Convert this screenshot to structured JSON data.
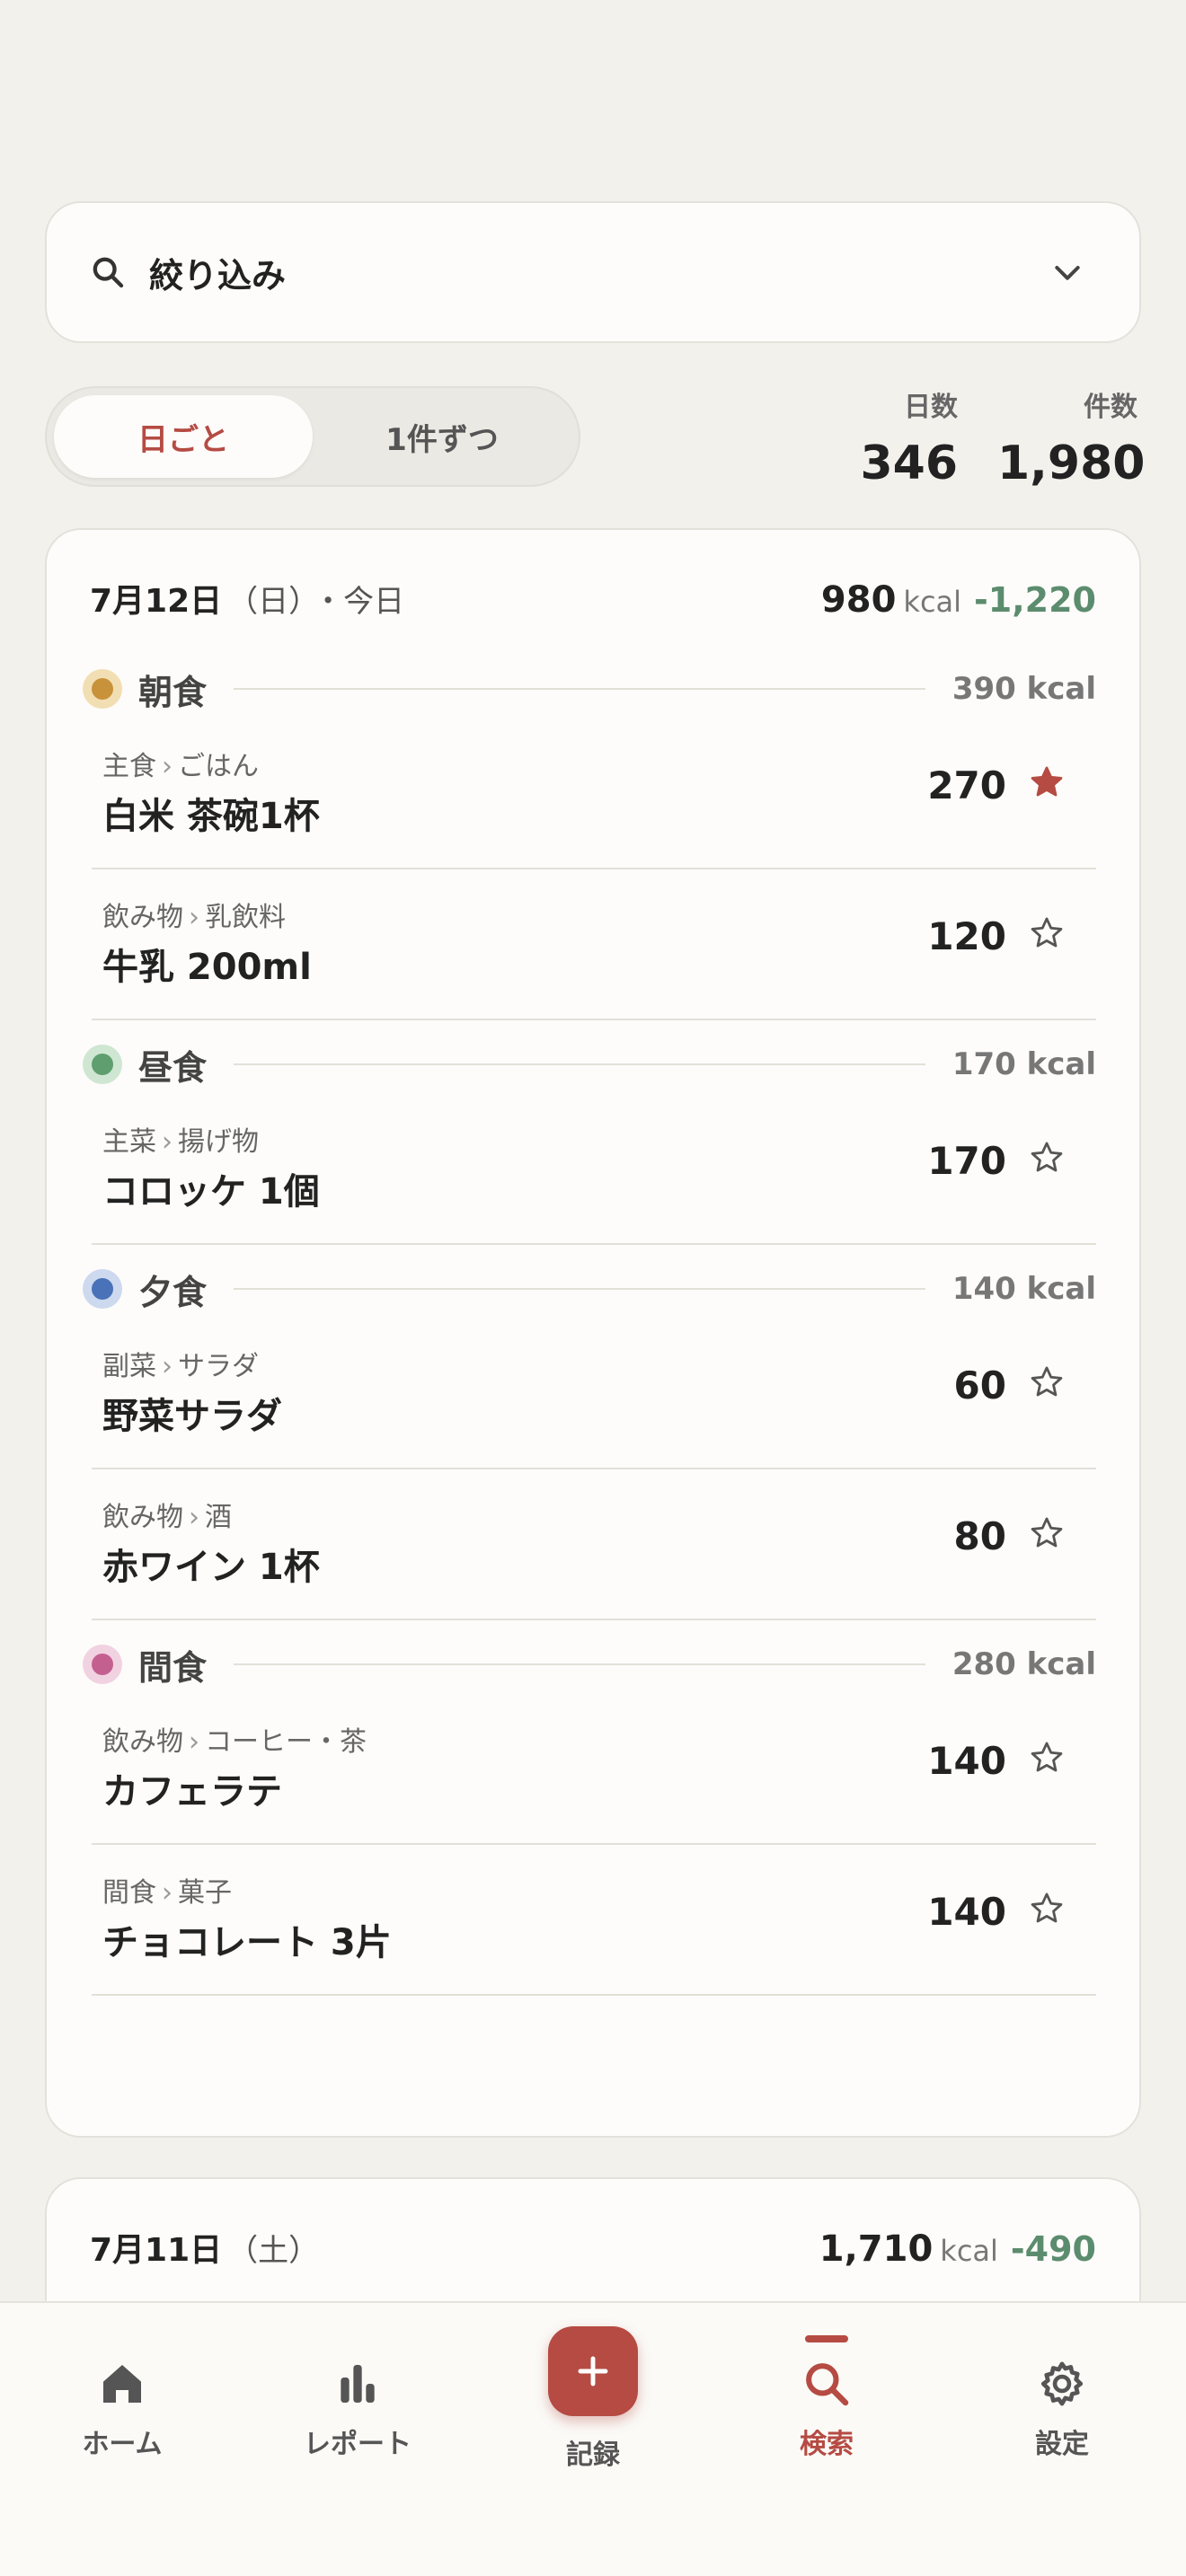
{
  "filter": {
    "label": "絞り込み"
  },
  "view_toggle": {
    "options": [
      "日ごと",
      "1件ずつ"
    ],
    "active": 0
  },
  "stats": [
    {
      "label": "日数",
      "value": "346"
    },
    {
      "label": "件数",
      "value": "1,980"
    }
  ],
  "days": [
    {
      "date": "7月12日",
      "weekday": "（日）",
      "today": "・今日",
      "total": "980",
      "unit": "kcal",
      "delta": "-1,220",
      "meals": [
        {
          "name": "朝食",
          "kcal": "390 kcal",
          "color": "#c8923a",
          "ring": "#f1dfb3",
          "items": [
            {
              "category": "主食",
              "subcategory": "ごはん",
              "name": "白米 茶碗1杯",
              "kcal": "270",
              "favorite": true
            },
            {
              "category": "飲み物",
              "subcategory": "乳飲料",
              "name": "牛乳 200ml",
              "kcal": "120",
              "favorite": false
            }
          ]
        },
        {
          "name": "昼食",
          "kcal": "170 kcal",
          "color": "#5f9e6e",
          "ring": "#cfe6d3",
          "items": [
            {
              "category": "主菜",
              "subcategory": "揚げ物",
              "name": "コロッケ 1個",
              "kcal": "170",
              "favorite": false
            }
          ]
        },
        {
          "name": "夕食",
          "kcal": "140 kcal",
          "color": "#4a72b8",
          "ring": "#cdd9ee",
          "items": [
            {
              "category": "副菜",
              "subcategory": "サラダ",
              "name": "野菜サラダ",
              "kcal": "60",
              "favorite": false
            },
            {
              "category": "飲み物",
              "subcategory": "酒",
              "name": "赤ワイン 1杯",
              "kcal": "80",
              "favorite": false
            }
          ]
        },
        {
          "name": "間食",
          "kcal": "280 kcal",
          "color": "#c4608f",
          "ring": "#f1d2e1",
          "items": [
            {
              "category": "飲み物",
              "subcategory": "コーヒー・茶",
              "name": "カフェラテ",
              "kcal": "140",
              "favorite": false
            },
            {
              "category": "間食",
              "subcategory": "菓子",
              "name": "チョコレート 3片",
              "kcal": "140",
              "favorite": false
            }
          ]
        }
      ]
    },
    {
      "date": "7月11日",
      "weekday": "（土）",
      "total": "1,710",
      "unit": "kcal",
      "delta": "-490"
    }
  ],
  "nav": {
    "items": [
      {
        "label": "ホーム",
        "icon": "home-icon"
      },
      {
        "label": "レポート",
        "icon": "bar-chart-icon"
      },
      {
        "label": "記録",
        "icon": "plus-icon"
      },
      {
        "label": "検索",
        "icon": "search-icon"
      },
      {
        "label": "設定",
        "icon": "gear-icon"
      }
    ],
    "active": 3
  },
  "colors": {
    "accent": "#b54b43",
    "positive": "#5c8c6e",
    "background": "#f3f1ec"
  },
  "separator": "›"
}
